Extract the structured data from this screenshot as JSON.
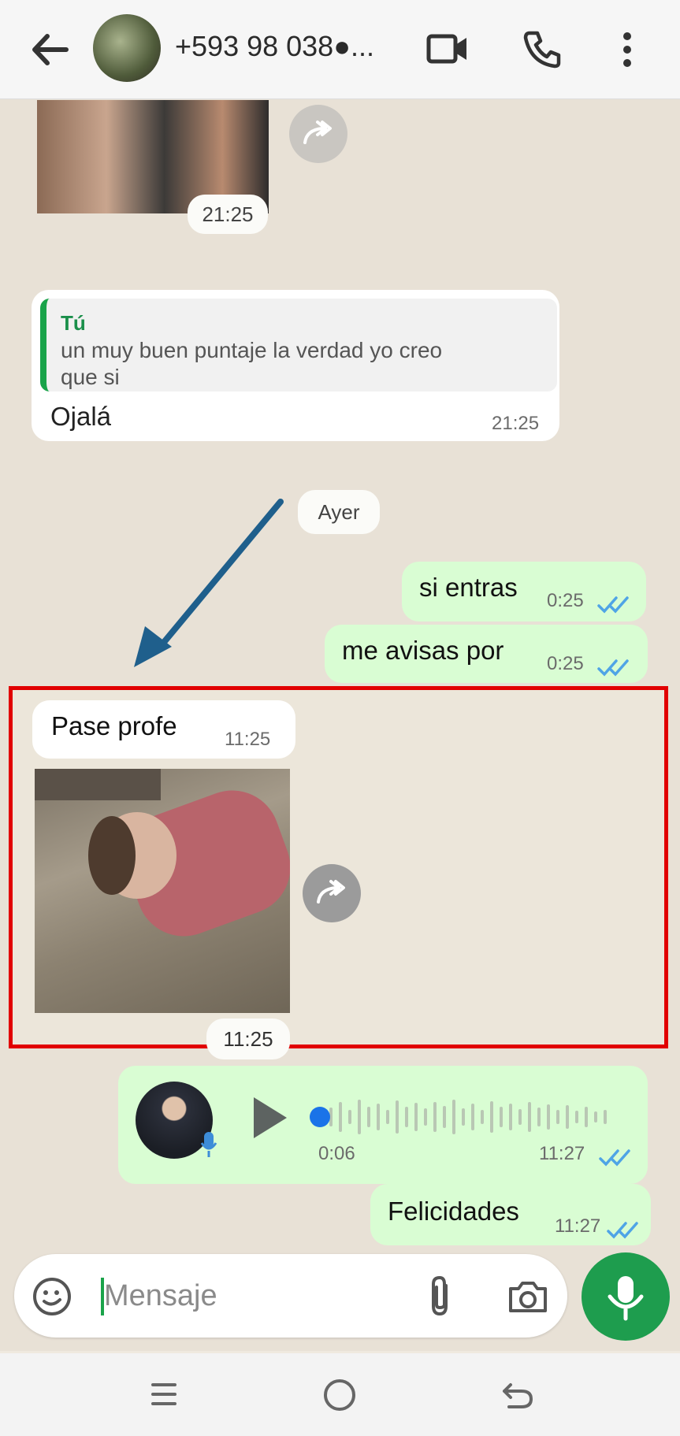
{
  "header": {
    "contact_name": "+593 98 038●...",
    "icons": [
      "back-arrow-icon",
      "video-call-icon",
      "phone-icon",
      "more-options-icon"
    ]
  },
  "messages": {
    "first_image_time": "21:25",
    "reply": {
      "quoted_author": "Tú",
      "quoted_text_line1": "un muy buen puntaje la verdad yo creo",
      "quoted_text_line2": "que si",
      "text": "Ojalá",
      "time": "21:25"
    },
    "date_chip": "Ayer",
    "out1": {
      "text": "si entras",
      "time": "0:25"
    },
    "out2": {
      "text": "me avisas por",
      "time": "0:25"
    },
    "in_text": {
      "text": "Pase profe",
      "time": "11:25"
    },
    "in_image_time": "11:25",
    "voice": {
      "duration": "0:06",
      "time": "11:27"
    },
    "out3": {
      "text": "Felicidades",
      "time": "11:27"
    }
  },
  "composer": {
    "placeholder": "Mensaje"
  },
  "colors": {
    "outgoing": "#d9fdd3",
    "accent_green": "#25a45a",
    "highlight_red": "#e10000",
    "arrow_blue": "#1f5f8c",
    "tick_blue": "#4fa4e6"
  }
}
